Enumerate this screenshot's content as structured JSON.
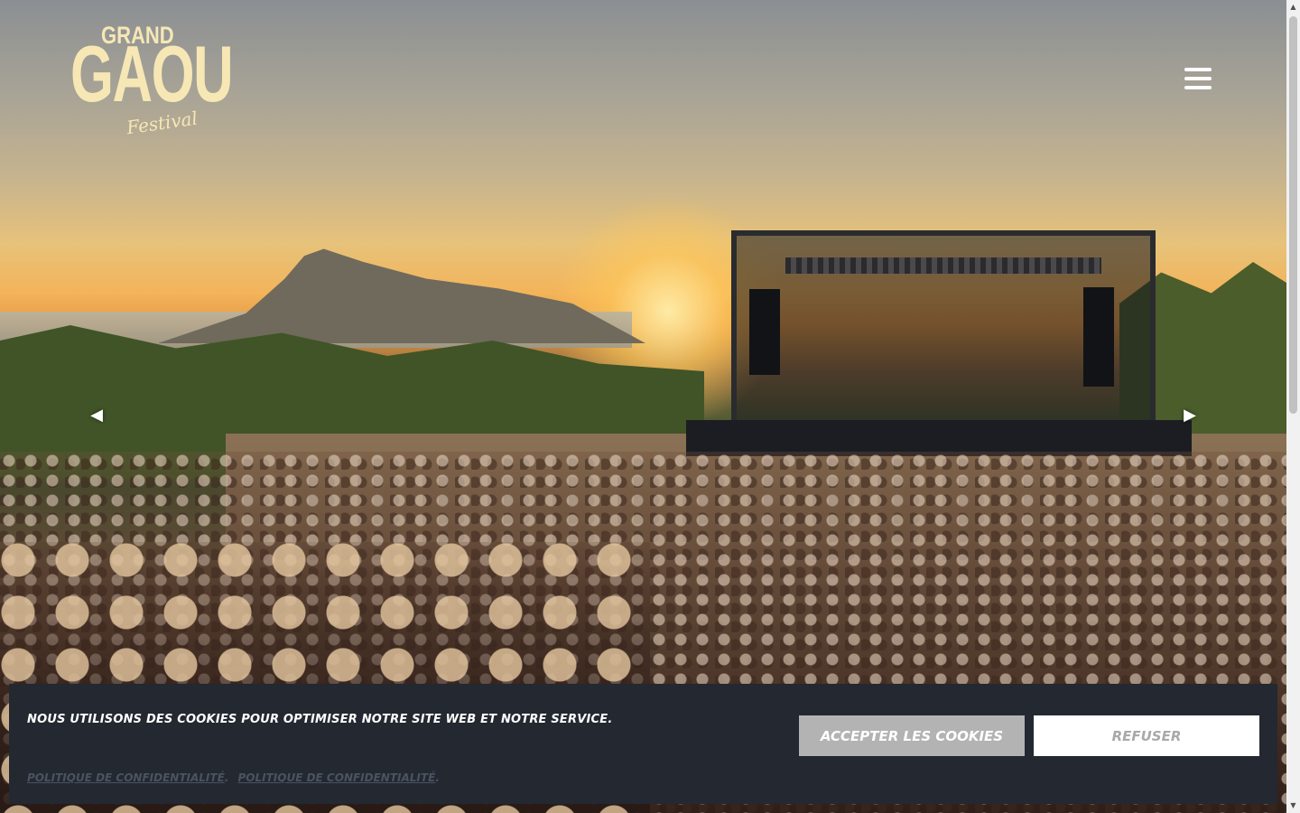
{
  "brand": {
    "logo_top": "GRAND",
    "logo_main": "GAOU",
    "logo_script": "Festival",
    "logo_color": "#f6e7b5"
  },
  "header": {
    "menu_icon": "hamburger-icon"
  },
  "carousel": {
    "prev_icon": "chevron-left-icon",
    "next_icon": "chevron-right-icon",
    "prev_glyph": "◀",
    "next_glyph": "▶",
    "hero_description_icon": "festival-hero-photo"
  },
  "cookie_banner": {
    "message": "Nous utilisons des cookies pour optimiser notre site web et notre service.",
    "accept_label": "Accepter les cookies",
    "refuse_label": "Refuser",
    "link1": "Politique de confidentialité",
    "link2": "Politique de confidentialité",
    "separator": ".",
    "background": "#232831",
    "accept_bg": "#b3b3b3",
    "refuse_bg": "#ffffff"
  }
}
